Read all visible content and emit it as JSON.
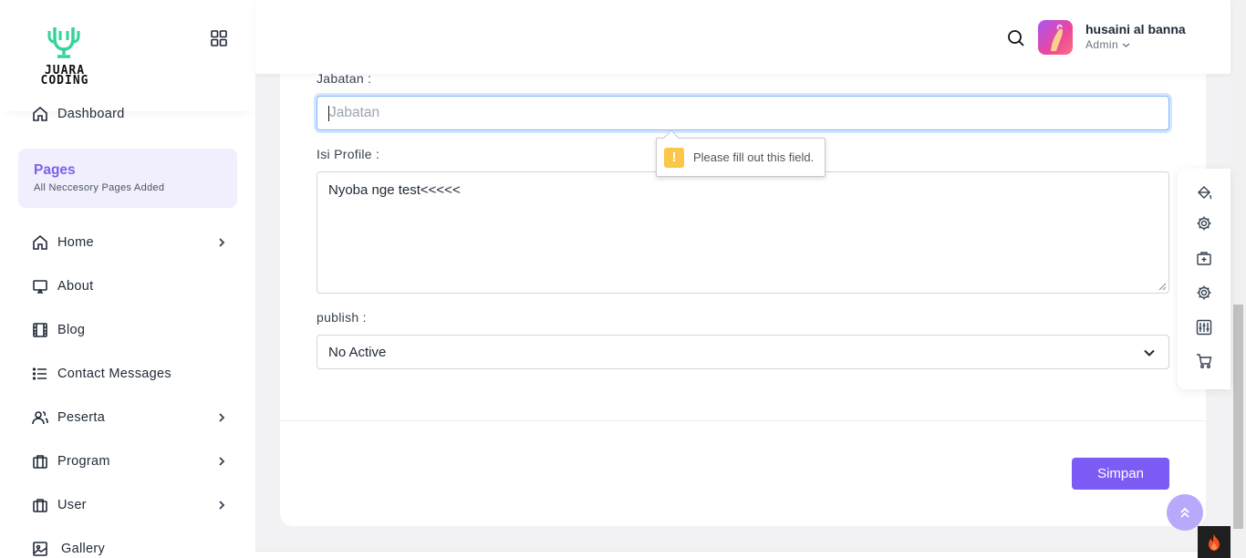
{
  "brand": {
    "logo_text_line1": "JUARA",
    "logo_text_line2": "CODING",
    "accent": "#34d399"
  },
  "sidebar": {
    "dashboard": "Dashboard",
    "pages_title": "Pages",
    "pages_subtitle": "All Neccesory Pages Added",
    "items": [
      {
        "label": "Home",
        "icon": "home-icon",
        "has_children": true
      },
      {
        "label": "About",
        "icon": "monitor-icon",
        "has_children": false
      },
      {
        "label": "Blog",
        "icon": "film-icon",
        "has_children": false
      },
      {
        "label": "Contact Messages",
        "icon": "list-icon",
        "has_children": false
      },
      {
        "label": "Peserta",
        "icon": "users-icon",
        "has_children": true
      },
      {
        "label": "Program",
        "icon": "briefcase-icon",
        "has_children": true
      },
      {
        "label": "User",
        "icon": "briefcase-icon",
        "has_children": true
      },
      {
        "label": "Gallery",
        "icon": "image-icon",
        "has_children": false
      }
    ]
  },
  "header": {
    "user_name": "husaini al banna",
    "user_role": "Admin"
  },
  "form": {
    "jabatan_label": "Jabatan :",
    "jabatan_placeholder": "Jabatan",
    "jabatan_value": "",
    "isi_profile_label": "Isi Profile :",
    "isi_profile_value": "Nyoba nge test<<<<<",
    "publish_label": "publish :",
    "publish_value": "No Active",
    "save_label": "Simpan"
  },
  "validation": {
    "message": "Please fill out this field."
  },
  "colors": {
    "primary": "#7c5cf5",
    "focus_border": "#86b7fe",
    "warning": "#fcc748"
  }
}
